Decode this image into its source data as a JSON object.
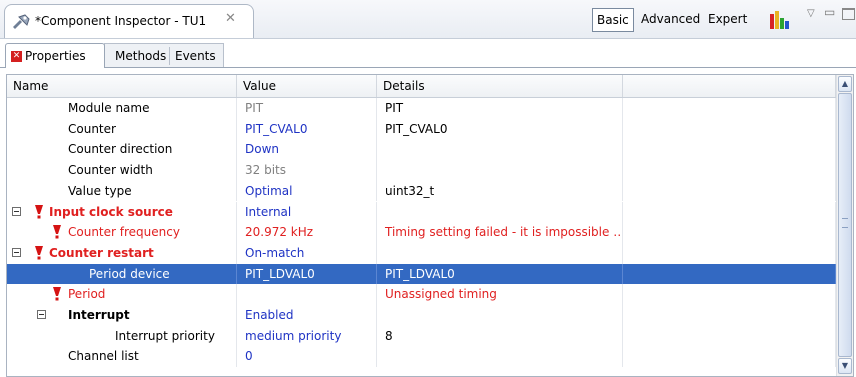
{
  "view": {
    "title": "*Component Inspector - TU1",
    "close_glyph": "✕",
    "icon": "component-inspector-icon"
  },
  "modes": {
    "basic": "Basic",
    "advanced": "Advanced",
    "expert": "Expert",
    "active": "Basic"
  },
  "toolbar": {
    "chart_icon": "bar-chart-icon",
    "view_menu_icon": "view-menu-icon",
    "view_menu_glyph": "▽",
    "minimize_icon": "minimize-icon",
    "minimize_glyph": "▭",
    "maximize_icon": "maximize-icon"
  },
  "tabs": {
    "properties": "Properties",
    "methods": "Methods",
    "events": "Events",
    "error_glyph": "✕"
  },
  "table": {
    "columns": {
      "name": "Name",
      "value": "Value",
      "details": "Details"
    },
    "scroll_up": "▲",
    "scroll_down": "▼",
    "rows": [
      {
        "name": "Module name",
        "value": "PIT",
        "details": "PIT"
      },
      {
        "name": "Counter",
        "value": "PIT_CVAL0",
        "details": "PIT_CVAL0"
      },
      {
        "name": "Counter direction",
        "value": "Down",
        "details": ""
      },
      {
        "name": "Counter width",
        "value": "32 bits",
        "details": ""
      },
      {
        "name": "Value type",
        "value": "Optimal",
        "details": "uint32_t"
      },
      {
        "name": "Input clock source",
        "value": "Internal",
        "details": ""
      },
      {
        "name": "Counter frequency",
        "value": "20.972 kHz",
        "details": "Timing setting failed - it is impossible …"
      },
      {
        "name": "Counter restart",
        "value": "On-match",
        "details": ""
      },
      {
        "name": "Period device",
        "value": "PIT_LDVAL0",
        "details": "PIT_LDVAL0"
      },
      {
        "name": "Period",
        "value": "",
        "details": "Unassigned timing"
      },
      {
        "name": "Interrupt",
        "value": "Enabled",
        "details": ""
      },
      {
        "name": "Interrupt priority",
        "value": "medium priority",
        "details": "8"
      },
      {
        "name": "Channel list",
        "value": "0",
        "details": ""
      }
    ]
  },
  "colors": {
    "selection": "#3369c2",
    "error_text": "#e02020",
    "value_blue": "#1f33c4",
    "readonly_gray": "#808080"
  }
}
